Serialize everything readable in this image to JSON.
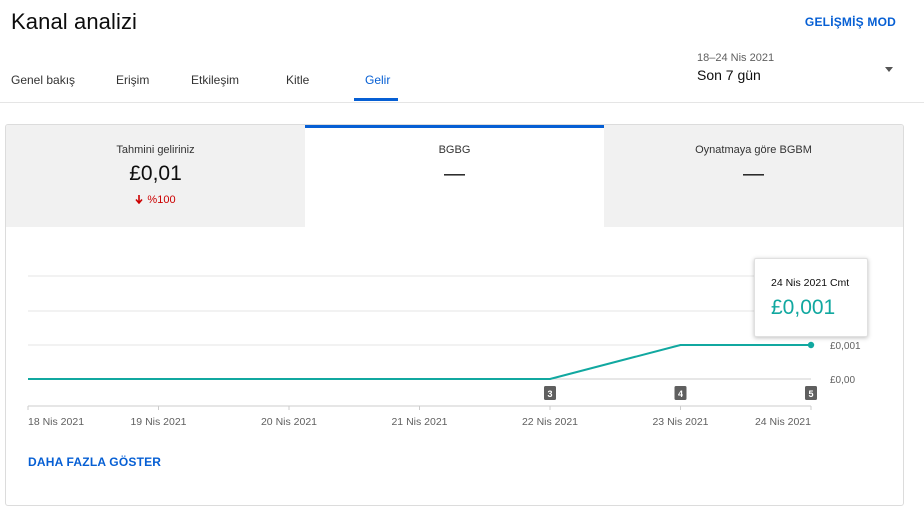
{
  "page": {
    "title": "Kanal analizi",
    "advanced_mode": "GELİŞMİŞ MOD"
  },
  "tabs": [
    {
      "label": "Genel bakış",
      "active": false
    },
    {
      "label": "Erişim",
      "active": false
    },
    {
      "label": "Etkileşim",
      "active": false
    },
    {
      "label": "Kitle",
      "active": false
    },
    {
      "label": "Gelir",
      "active": true
    }
  ],
  "date_range": {
    "dates": "18–24 Nis 2021",
    "label": "Son 7 gün"
  },
  "metrics": [
    {
      "label": "Tahmini geliriniz",
      "value": "£0,01",
      "change": "%100",
      "change_direction": "down"
    },
    {
      "label": "BGBG",
      "value": "—"
    },
    {
      "label": "Oynatmaya göre BGBM",
      "value": "—"
    }
  ],
  "tooltip": {
    "date": "24 Nis 2021 Cmt",
    "value": "£0,001"
  },
  "show_more": "DAHA FAZLA GÖSTER",
  "colors": {
    "accent": "#065fd4",
    "line": "#11a8a0",
    "negative": "#cc0000"
  },
  "chart_data": {
    "type": "line",
    "x": [
      "18 Nis 2021",
      "19 Nis 2021",
      "20 Nis 2021",
      "21 Nis 2021",
      "22 Nis 2021",
      "23 Nis 2021",
      "24 Nis 2021"
    ],
    "series": [
      {
        "values": [
          0,
          0,
          0,
          0,
          0,
          0.001,
          0.001
        ]
      }
    ],
    "y_ticks": [
      "£0,00",
      "£0,001"
    ],
    "ylim": [
      0,
      0.001
    ],
    "grid": true,
    "markers": [
      {
        "x": "22 Nis 2021",
        "label": "3"
      },
      {
        "x": "23 Nis 2021",
        "label": "4"
      },
      {
        "x": "24 Nis 2021",
        "label": "5"
      }
    ]
  }
}
